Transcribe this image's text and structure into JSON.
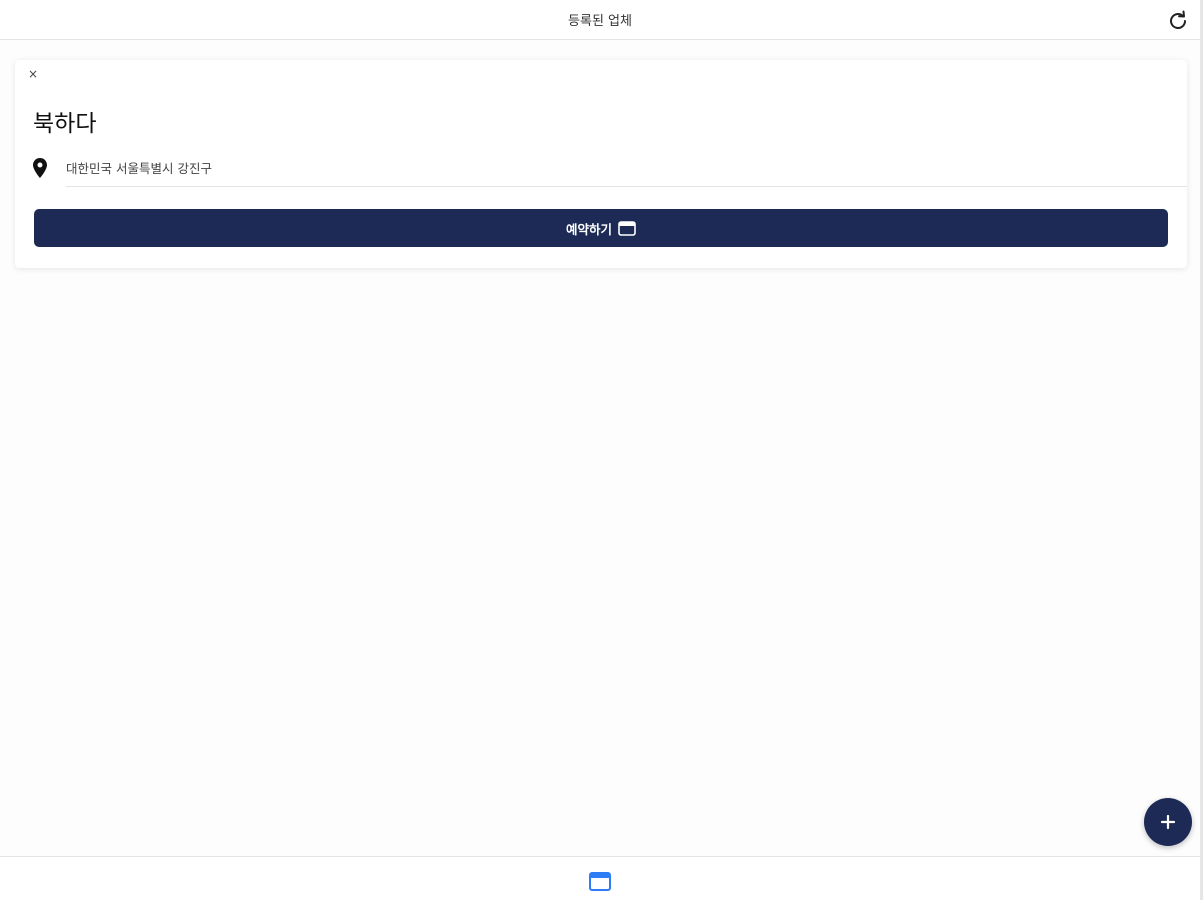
{
  "header": {
    "title": "등록된 업체",
    "refresh_icon": "refresh-icon"
  },
  "card": {
    "close_label": "×",
    "title": "북하다",
    "address": "대한민국 서울특별시 강진구",
    "location_icon": "map-pin-icon",
    "reserve_label": "예약하기",
    "reserve_icon": "calendar-icon"
  },
  "fab": {
    "icon": "plus-icon"
  },
  "footer": {
    "tab_icon": "calendar-icon"
  },
  "colors": {
    "primary": "#1c2a55",
    "tab_active": "#2f7df6",
    "background": "#fdfdfd"
  }
}
